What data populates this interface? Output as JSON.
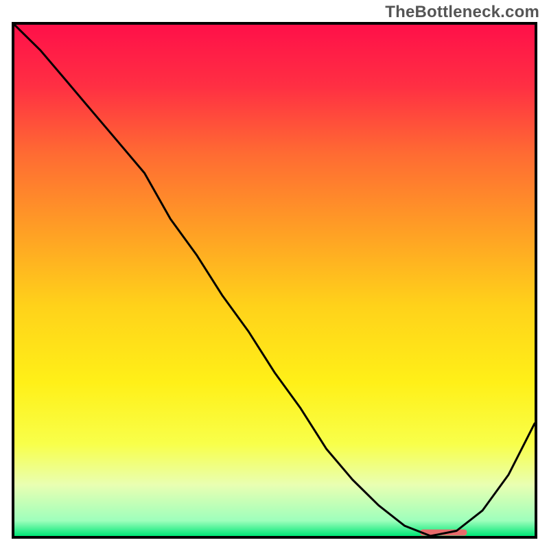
{
  "watermark": "TheBottleneck.com",
  "chart_data": {
    "type": "line",
    "title": "",
    "xlabel": "",
    "ylabel": "",
    "x": [
      0.0,
      0.05,
      0.1,
      0.15,
      0.2,
      0.25,
      0.3,
      0.35,
      0.4,
      0.45,
      0.5,
      0.55,
      0.6,
      0.65,
      0.7,
      0.75,
      0.8,
      0.85,
      0.9,
      0.95,
      1.0
    ],
    "values": [
      1.0,
      0.95,
      0.89,
      0.83,
      0.77,
      0.71,
      0.62,
      0.55,
      0.47,
      0.4,
      0.32,
      0.25,
      0.17,
      0.11,
      0.06,
      0.02,
      0.0,
      0.01,
      0.05,
      0.12,
      0.22
    ],
    "xlim": [
      0,
      1
    ],
    "ylim": [
      0,
      1
    ],
    "series_name": "bottleneck-curve",
    "background": "vertical-gradient",
    "gradient_stops": [
      {
        "pos": 0.0,
        "color": "#ff1049"
      },
      {
        "pos": 0.12,
        "color": "#ff2f43"
      },
      {
        "pos": 0.25,
        "color": "#ff6a33"
      },
      {
        "pos": 0.4,
        "color": "#ff9e25"
      },
      {
        "pos": 0.55,
        "color": "#ffd21a"
      },
      {
        "pos": 0.7,
        "color": "#fff018"
      },
      {
        "pos": 0.82,
        "color": "#f8ff4a"
      },
      {
        "pos": 0.9,
        "color": "#e9ffb2"
      },
      {
        "pos": 0.97,
        "color": "#9effbc"
      },
      {
        "pos": 1.0,
        "color": "#00e676"
      }
    ],
    "line_color": "#000000",
    "line_width": 3,
    "marker": {
      "x_range": [
        0.78,
        0.87
      ],
      "y": 0.006,
      "color": "#e86b6b"
    }
  }
}
